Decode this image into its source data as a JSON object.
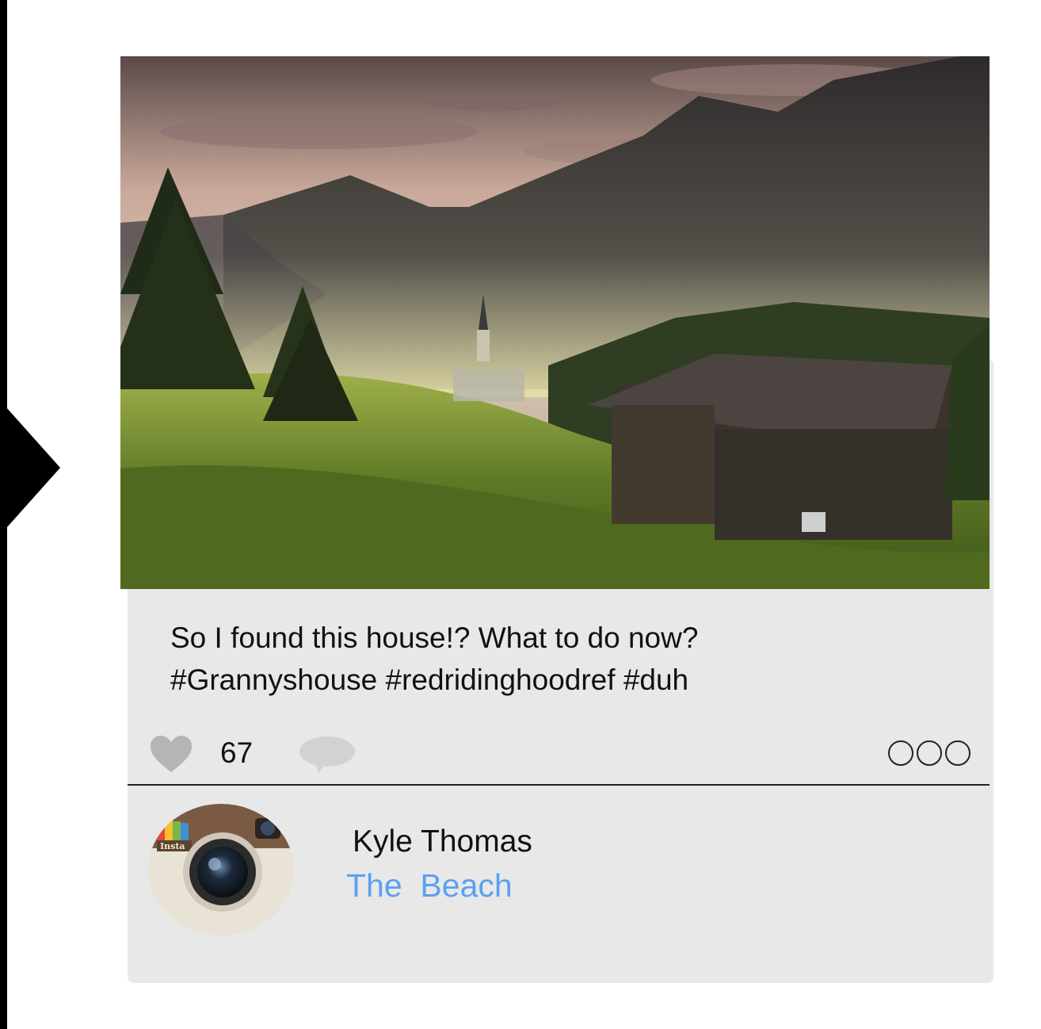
{
  "post": {
    "photo_alt": "mountain valley with wooden hut",
    "caption_line1": "So I found this house!? What to do now?",
    "caption_line2": "#Grannyshouse #redridinghoodref #duh",
    "likes": "67"
  },
  "user": {
    "name": "Kyle Thomas",
    "location": "The  Beach",
    "avatar_badge": "Insta"
  },
  "icons": {
    "like": "heart-icon",
    "comment": "comment-bubble-icon",
    "more": "more-options-icon",
    "avatar": "camera-icon"
  },
  "colors": {
    "location_link": "#5aa0f2",
    "card_background": "#e8e8e8",
    "icon_gray": "#b5b5b5"
  }
}
